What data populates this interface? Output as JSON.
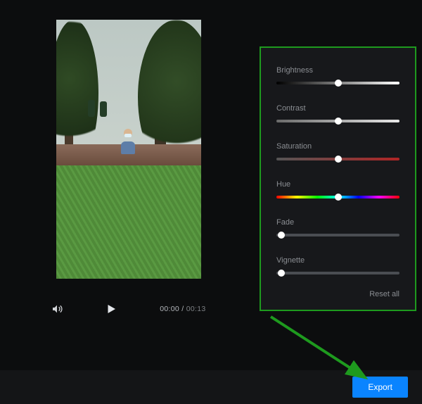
{
  "player": {
    "current_time": "00:00",
    "separator": " / ",
    "total_time": "00:13"
  },
  "adjust": {
    "brightness": {
      "label": "Brightness",
      "value": 50
    },
    "contrast": {
      "label": "Contrast",
      "value": 50
    },
    "saturation": {
      "label": "Saturation",
      "value": 50
    },
    "hue": {
      "label": "Hue",
      "value": 50
    },
    "fade": {
      "label": "Fade",
      "value": 4
    },
    "vignette": {
      "label": "Vignette",
      "value": 4
    },
    "reset_label": "Reset all"
  },
  "actions": {
    "export_label": "Export"
  },
  "colors": {
    "accent": "#0a84ff",
    "annotation": "#1e9a1e"
  }
}
